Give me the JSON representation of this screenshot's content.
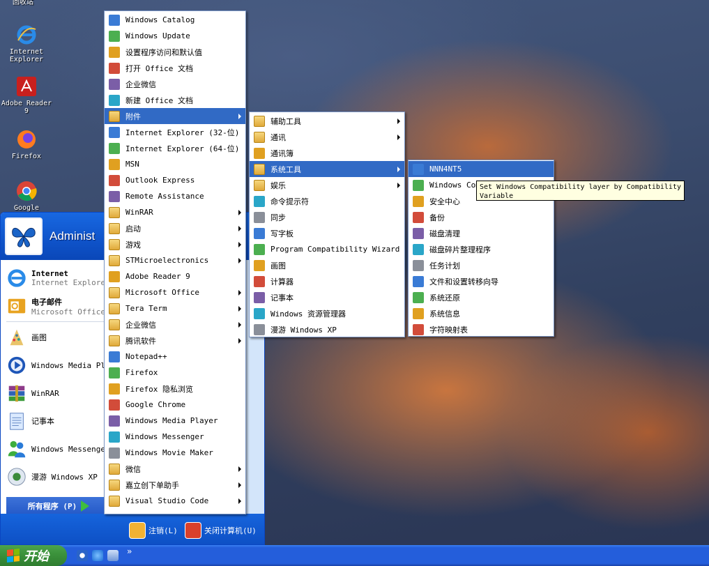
{
  "desktop": {
    "top_label": "回收站",
    "icons": [
      {
        "label": "Internet Explorer"
      },
      {
        "label": "Adobe Reader 9"
      },
      {
        "label": "Firefox"
      },
      {
        "label": "Google"
      }
    ]
  },
  "start_menu": {
    "user": "Administ",
    "pinned": [
      {
        "title": "Internet",
        "subtitle": "Internet Explorer"
      },
      {
        "title": "电子邮件",
        "subtitle": "Microsoft Office"
      }
    ],
    "recent": [
      "画图",
      "Windows Media Pla",
      "WinRAR",
      "记事本",
      "Windows Messenger",
      "漫游 Windows XP"
    ],
    "all_programs": "所有程序 (P)",
    "logoff": "注销(L)",
    "shutdown": "关闭计算机(U)"
  },
  "programs_menu": {
    "items": [
      {
        "label": "Windows Catalog",
        "sub": false
      },
      {
        "label": "Windows Update",
        "sub": false
      },
      {
        "label": "设置程序访问和默认值",
        "sub": false
      },
      {
        "label": "打开 Office 文档",
        "sub": false
      },
      {
        "label": "企业微信",
        "sub": false
      },
      {
        "label": "新建 Office 文档",
        "sub": false
      },
      {
        "label": "附件",
        "sub": true,
        "selected": true
      },
      {
        "label": "Internet Explorer (32-位)",
        "sub": false
      },
      {
        "label": "Internet Explorer (64-位)",
        "sub": false
      },
      {
        "label": "MSN",
        "sub": false
      },
      {
        "label": "Outlook Express",
        "sub": false
      },
      {
        "label": "Remote Assistance",
        "sub": false
      },
      {
        "label": "WinRAR",
        "sub": true
      },
      {
        "label": "启动",
        "sub": true
      },
      {
        "label": "游戏",
        "sub": true
      },
      {
        "label": "STMicroelectronics",
        "sub": true
      },
      {
        "label": "Adobe Reader 9",
        "sub": false
      },
      {
        "label": "Microsoft Office",
        "sub": true
      },
      {
        "label": "Tera Term",
        "sub": true
      },
      {
        "label": "企业微信",
        "sub": true
      },
      {
        "label": "腾讯软件",
        "sub": true
      },
      {
        "label": "Notepad++",
        "sub": false
      },
      {
        "label": "Firefox",
        "sub": false
      },
      {
        "label": "Firefox 隐私浏览",
        "sub": false
      },
      {
        "label": "Google Chrome",
        "sub": false
      },
      {
        "label": "Windows Media Player",
        "sub": false
      },
      {
        "label": "Windows Messenger",
        "sub": false
      },
      {
        "label": "Windows Movie Maker",
        "sub": false
      },
      {
        "label": "微信",
        "sub": true
      },
      {
        "label": "嘉立创下单助手",
        "sub": true
      },
      {
        "label": "Visual Studio Code",
        "sub": true
      }
    ]
  },
  "accessories_menu": {
    "items": [
      {
        "label": "辅助工具",
        "sub": true
      },
      {
        "label": "通讯",
        "sub": true
      },
      {
        "label": "通讯簿",
        "sub": false
      },
      {
        "label": "系统工具",
        "sub": true,
        "selected": true
      },
      {
        "label": "娱乐",
        "sub": true
      },
      {
        "label": "命令提示符",
        "sub": false
      },
      {
        "label": "同步",
        "sub": false
      },
      {
        "label": "写字板",
        "sub": false
      },
      {
        "label": "Program Compatibility Wizard",
        "sub": false
      },
      {
        "label": "画图",
        "sub": false
      },
      {
        "label": "计算器",
        "sub": false
      },
      {
        "label": "记事本",
        "sub": false
      },
      {
        "label": "Windows 资源管理器",
        "sub": false
      },
      {
        "label": "漫游 Windows XP",
        "sub": false
      }
    ]
  },
  "system_tools_menu": {
    "items": [
      {
        "label": "NNN4NT5",
        "selected": true
      },
      {
        "label": "Windows Com"
      },
      {
        "label": "安全中心"
      },
      {
        "label": "备份"
      },
      {
        "label": "磁盘清理"
      },
      {
        "label": "磁盘碎片整理程序"
      },
      {
        "label": "任务计划"
      },
      {
        "label": "文件和设置转移向导"
      },
      {
        "label": "系统还原"
      },
      {
        "label": "系统信息"
      },
      {
        "label": "字符映射表"
      }
    ]
  },
  "tooltip": "Set Windows Compatibility layer by Compatibility Variable",
  "taskbar": {
    "start_label": "开始",
    "overflow": "»"
  },
  "colors": {
    "selection": "#316ac5",
    "taskbar": "#245edb",
    "start_green": "#3c933c"
  }
}
